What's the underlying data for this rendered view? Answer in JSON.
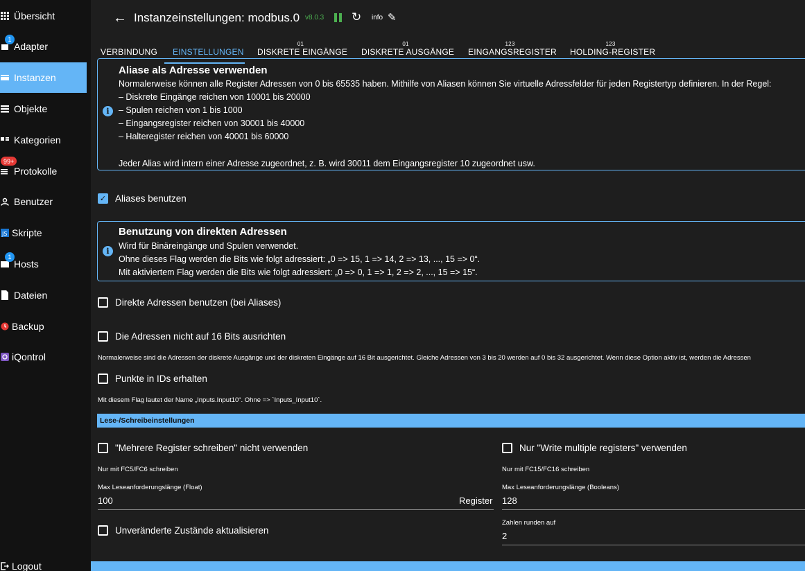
{
  "sidebar": {
    "items": [
      {
        "label": "Übersicht",
        "icon": "grid-icon"
      },
      {
        "label": "Adapter",
        "icon": "adapter-icon",
        "badge": "1"
      },
      {
        "label": "Instanzen",
        "icon": "instances-icon",
        "active": true
      },
      {
        "label": "Objekte",
        "icon": "objects-icon"
      },
      {
        "label": "Kategorien",
        "icon": "categories-icon"
      },
      {
        "label": "Protokolle",
        "icon": "logs-icon",
        "badge": "99+"
      },
      {
        "label": "Benutzer",
        "icon": "user-icon"
      },
      {
        "label": "Skripte",
        "icon": "scripts-icon"
      },
      {
        "label": "Hosts",
        "icon": "hosts-icon",
        "badge": "1"
      },
      {
        "label": "Dateien",
        "icon": "file-icon"
      },
      {
        "label": "Backup",
        "icon": "backup-icon"
      },
      {
        "label": "iQontrol",
        "icon": "iqontrol-icon"
      }
    ],
    "logout": "Logout"
  },
  "header": {
    "title": "Instanzeinstellungen: modbus.0",
    "version": "v8.0.3",
    "info": "info"
  },
  "tabs": [
    {
      "label": "VERBINDUNG",
      "sup": ""
    },
    {
      "label": "EINSTELLUNGEN",
      "sup": "",
      "active": true
    },
    {
      "label": "DISKRETE EINGÄNGE",
      "sup": "01"
    },
    {
      "label": "DISKRETE AUSGÄNGE",
      "sup": "01"
    },
    {
      "label": "EINGANGSREGISTER",
      "sup": "123"
    },
    {
      "label": "HOLDING-REGISTER",
      "sup": "123"
    }
  ],
  "alias_box": {
    "title": "Aliase als Adresse verwenden",
    "lines": [
      "Normalerweise können alle Register Adressen von 0 bis 65535 haben. Mithilfe von Aliasen können Sie virtuelle Adressfelder für jeden Registertyp definieren. In der Regel:",
      "– Diskrete Eingänge reichen von 10001 bis 20000",
      "– Spulen reichen von 1 bis 1000",
      "– Eingangsregister reichen von 30001 bis 40000",
      "– Halteregister reichen von 40001 bis 60000",
      "Jeder Alias wird intern einer Adresse zugeordnet, z. B. wird 30011 dem Eingangsregister 10 zugeordnet usw."
    ]
  },
  "use_aliases": {
    "label": "Aliases benutzen",
    "checked": true
  },
  "direct_box": {
    "title": "Benutzung von direkten Adressen",
    "lines": [
      "Wird für Binäreingänge und Spulen verwendet.",
      "Ohne dieses Flag werden die Bits wie folgt adressiert: „0 => 15, 1 => 14, 2 => 13, ..., 15 => 0“.",
      "Mit aktiviertem Flag werden die Bits wie folgt adressiert: „0 => 0, 1 => 1, 2 => 2, ..., 15 => 15“."
    ]
  },
  "direct_addresses": {
    "label": "Direkte Adressen benutzen (bei Aliases)",
    "checked": false
  },
  "no_align": {
    "label": "Die Adressen nicht auf 16 Bits ausrichten",
    "checked": false,
    "help": "Normalerweise sind die Adressen der diskrete Ausgänge und der diskreten Eingänge auf 16 Bit ausgerichtet. Gleiche Adressen von 3 bis 20 werden auf 0 bis 32 ausgerichtet. Wenn diese Option aktiv ist, werden die Adressen"
  },
  "keep_dots": {
    "label": "Punkte in IDs erhalten",
    "checked": false,
    "help": "Mit diesem Flag lautet der Name „Inputs.Input10“. Ohne => `Inputs_Input10`."
  },
  "rw_section": {
    "title": "Lese-/Schreibeinstellungen"
  },
  "no_multi": {
    "label": "\"Mehrere Register schreiben\" nicht verwenden",
    "checked": false,
    "help": "Nur mit FC5/FC6 schreiben"
  },
  "only_multi": {
    "label": "Nur \"Write multiple registers\" verwenden",
    "checked": false,
    "help": "Nur mit FC15/FC16 schreiben"
  },
  "max_float": {
    "label": "Max Leseanforderungslänge (Float)",
    "value": "100",
    "unit": "Register"
  },
  "max_bool": {
    "label": "Max Leseanforderungslänge (Booleans)",
    "value": "128"
  },
  "update_unchanged": {
    "label": "Unveränderte Zustände aktualisieren",
    "checked": false
  },
  "round": {
    "label": "Zahlen runden auf",
    "value": "2"
  },
  "colors": {
    "accent": "#64b5f6",
    "running": "#4caf50",
    "badge_red": "#e53935",
    "background": "#1e1e1e"
  }
}
